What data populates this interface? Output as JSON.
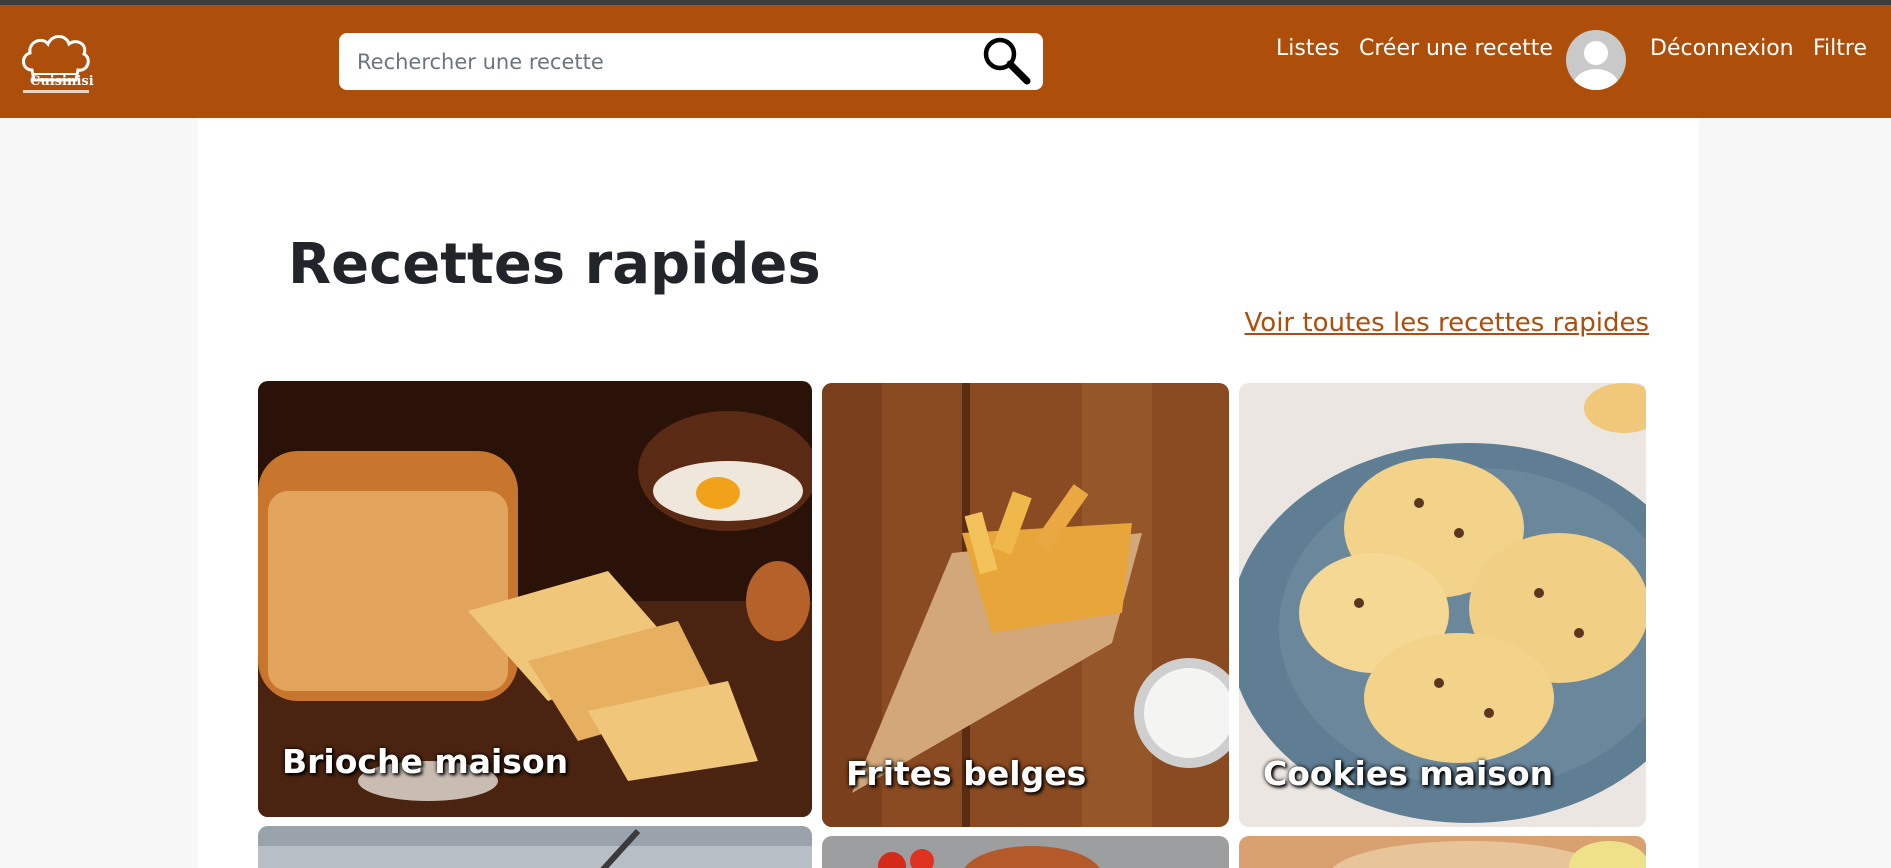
{
  "app": {
    "logo_text": "Cuisinisi"
  },
  "header": {
    "search": {
      "placeholder": "Rechercher une recette",
      "value": ""
    },
    "nav": {
      "lists": "Listes",
      "create": "Créer une recette",
      "logout": "Déconnexion",
      "filter": "Filtre"
    }
  },
  "main": {
    "section_title": "Recettes rapides",
    "see_all": "Voir toutes les recettes rapides",
    "recipes": [
      {
        "title": "Brioche maison"
      },
      {
        "title": "Frites belges"
      },
      {
        "title": "Cookies maison"
      }
    ]
  },
  "colors": {
    "brand": "#ad4e0a",
    "text": "#212529",
    "background": "#f7f7f7"
  }
}
